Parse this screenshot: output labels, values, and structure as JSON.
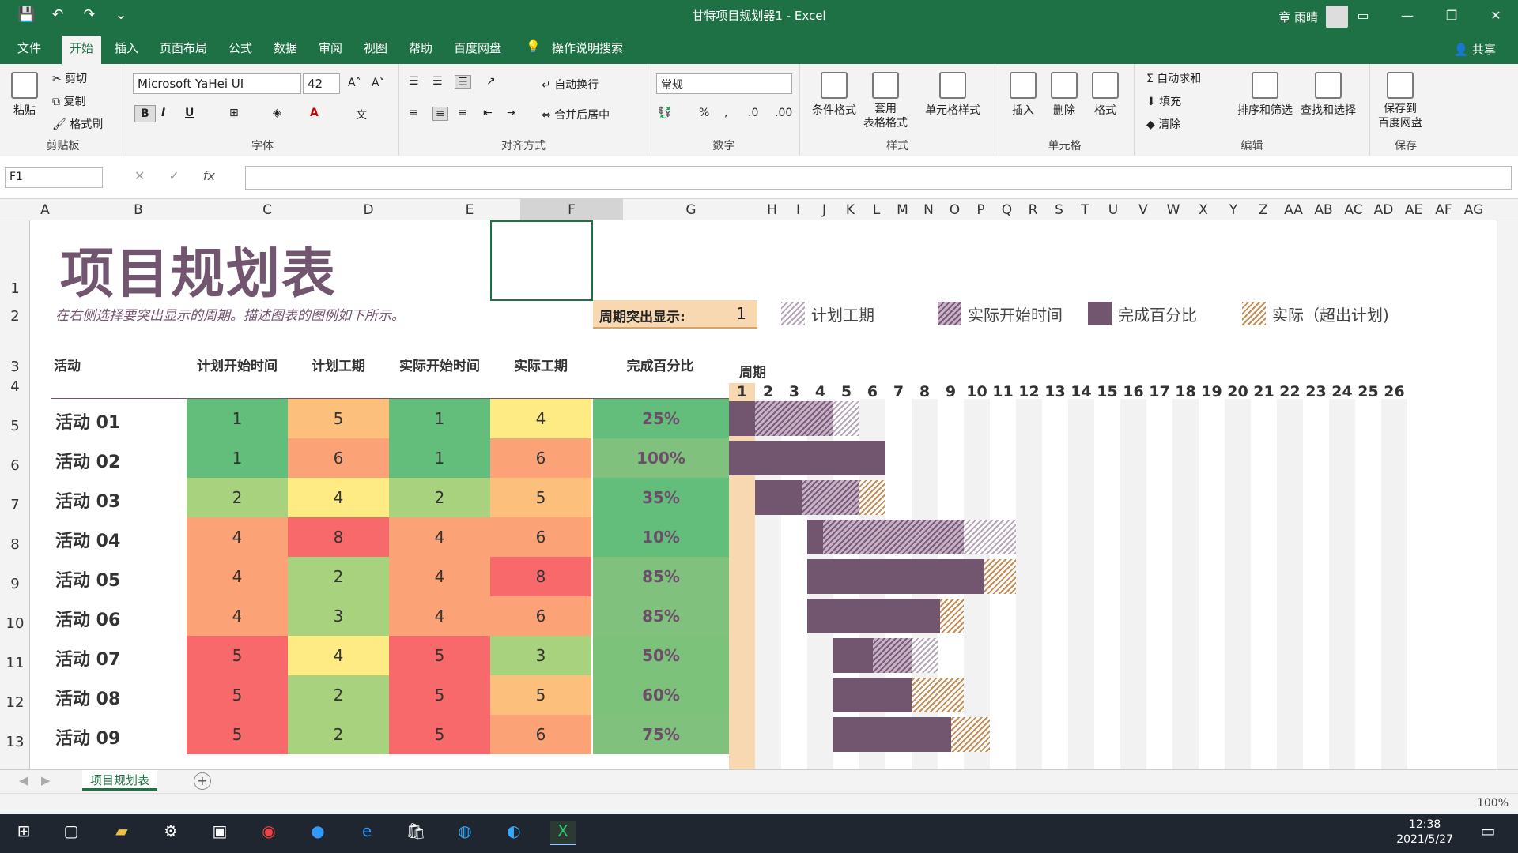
{
  "window": {
    "title": "甘特项目规划器1  -  Excel",
    "user": "章 雨晴"
  },
  "qat": {
    "save": "💾",
    "undo": "↶",
    "redo": "↷",
    "more": "⌄"
  },
  "menu_tabs": [
    "文件",
    "开始",
    "插入",
    "页面布局",
    "公式",
    "数据",
    "审阅",
    "视图",
    "帮助",
    "百度网盘",
    "操作说明搜索"
  ],
  "share": "共享",
  "ribbon": {
    "clipboard": {
      "label": "剪贴板",
      "paste": "粘贴",
      "cut": "剪切",
      "copy": "复制",
      "format_painter": "格式刷"
    },
    "font": {
      "label": "字体",
      "name": "Microsoft YaHei UI",
      "size": "42",
      "bold": "B",
      "italic": "I",
      "underline": "U"
    },
    "align": {
      "label": "对齐方式",
      "wrap": "自动换行",
      "merge": "合并后居中"
    },
    "number": {
      "label": "数字",
      "format": "常规"
    },
    "styles": {
      "label": "样式",
      "cond": "条件格式",
      "table": "套用\n表格格式",
      "cell": "单元格样式"
    },
    "cells": {
      "label": "单元格",
      "insert": "插入",
      "delete": "删除",
      "format": "格式"
    },
    "edit": {
      "label": "编辑",
      "autosum": "自动求和",
      "fill": "填充",
      "clear": "清除",
      "sort": "排序和筛选",
      "find": "查找和选择"
    },
    "save": {
      "label": "保存",
      "baidu": "保存到\n百度网盘"
    }
  },
  "namebox": "F1",
  "fx": "fx",
  "columns": [
    "A",
    "B",
    "C",
    "D",
    "E",
    "F",
    "G",
    "H",
    "I",
    "J",
    "K",
    "L",
    "M",
    "N",
    "O",
    "P",
    "Q",
    "R",
    "S",
    "T",
    "U",
    "V",
    "W",
    "X",
    "Y",
    "Z",
    "AA",
    "AB",
    "AC",
    "AD",
    "AE",
    "AF",
    "AG"
  ],
  "rows": [
    "1",
    "2",
    "3",
    "4",
    "5",
    "6",
    "7",
    "8",
    "9",
    "10",
    "11",
    "12",
    "13"
  ],
  "sheet": {
    "title": "项目规划表",
    "subtitle": "在右侧选择要突出显示的周期。描述图表的图例如下所示。",
    "highlight_label": "周期突出显示:",
    "highlight_value": "1",
    "legend": [
      "计划工期",
      "实际开始时间",
      "完成百分比",
      "实际（超出计划)"
    ],
    "headers": {
      "activity": "活动",
      "plan_start": "计划开始时间",
      "plan_dur": "计划工期",
      "actual_start": "实际开始时间",
      "actual_dur": "实际工期",
      "percent": "完成百分比",
      "period": "周期"
    },
    "periods": [
      "1",
      "2",
      "3",
      "4",
      "5",
      "6",
      "7",
      "8",
      "9",
      "10",
      "11",
      "12",
      "13",
      "14",
      "15",
      "16",
      "17",
      "18",
      "19",
      "20",
      "21",
      "22",
      "23",
      "24",
      "25",
      "26"
    ],
    "activities": [
      {
        "name": "活动 01",
        "ps": "1",
        "pd": "5",
        "as": "1",
        "ad": "4",
        "pct": "25%"
      },
      {
        "name": "活动 02",
        "ps": "1",
        "pd": "6",
        "as": "1",
        "ad": "6",
        "pct": "100%"
      },
      {
        "name": "活动 03",
        "ps": "2",
        "pd": "4",
        "as": "2",
        "ad": "5",
        "pct": "35%"
      },
      {
        "name": "活动 04",
        "ps": "4",
        "pd": "8",
        "as": "4",
        "ad": "6",
        "pct": "10%"
      },
      {
        "name": "活动 05",
        "ps": "4",
        "pd": "2",
        "as": "4",
        "ad": "8",
        "pct": "85%"
      },
      {
        "name": "活动 06",
        "ps": "4",
        "pd": "3",
        "as": "4",
        "ad": "6",
        "pct": "85%"
      },
      {
        "name": "活动 07",
        "ps": "5",
        "pd": "4",
        "as": "5",
        "ad": "3",
        "pct": "50%"
      },
      {
        "name": "活动 08",
        "ps": "5",
        "pd": "2",
        "as": "5",
        "ad": "5",
        "pct": "60%"
      },
      {
        "name": "活动 09",
        "ps": "5",
        "pd": "2",
        "as": "5",
        "ad": "6",
        "pct": "75%"
      }
    ]
  },
  "sheet_tab": "项目规划表",
  "zoom": "100%",
  "clock": {
    "time": "12:38",
    "date": "2021/5/27"
  },
  "colors": {
    "excel_green": "#1e7145",
    "accent_purple": "#72566f",
    "orange": "#e8a74f"
  }
}
